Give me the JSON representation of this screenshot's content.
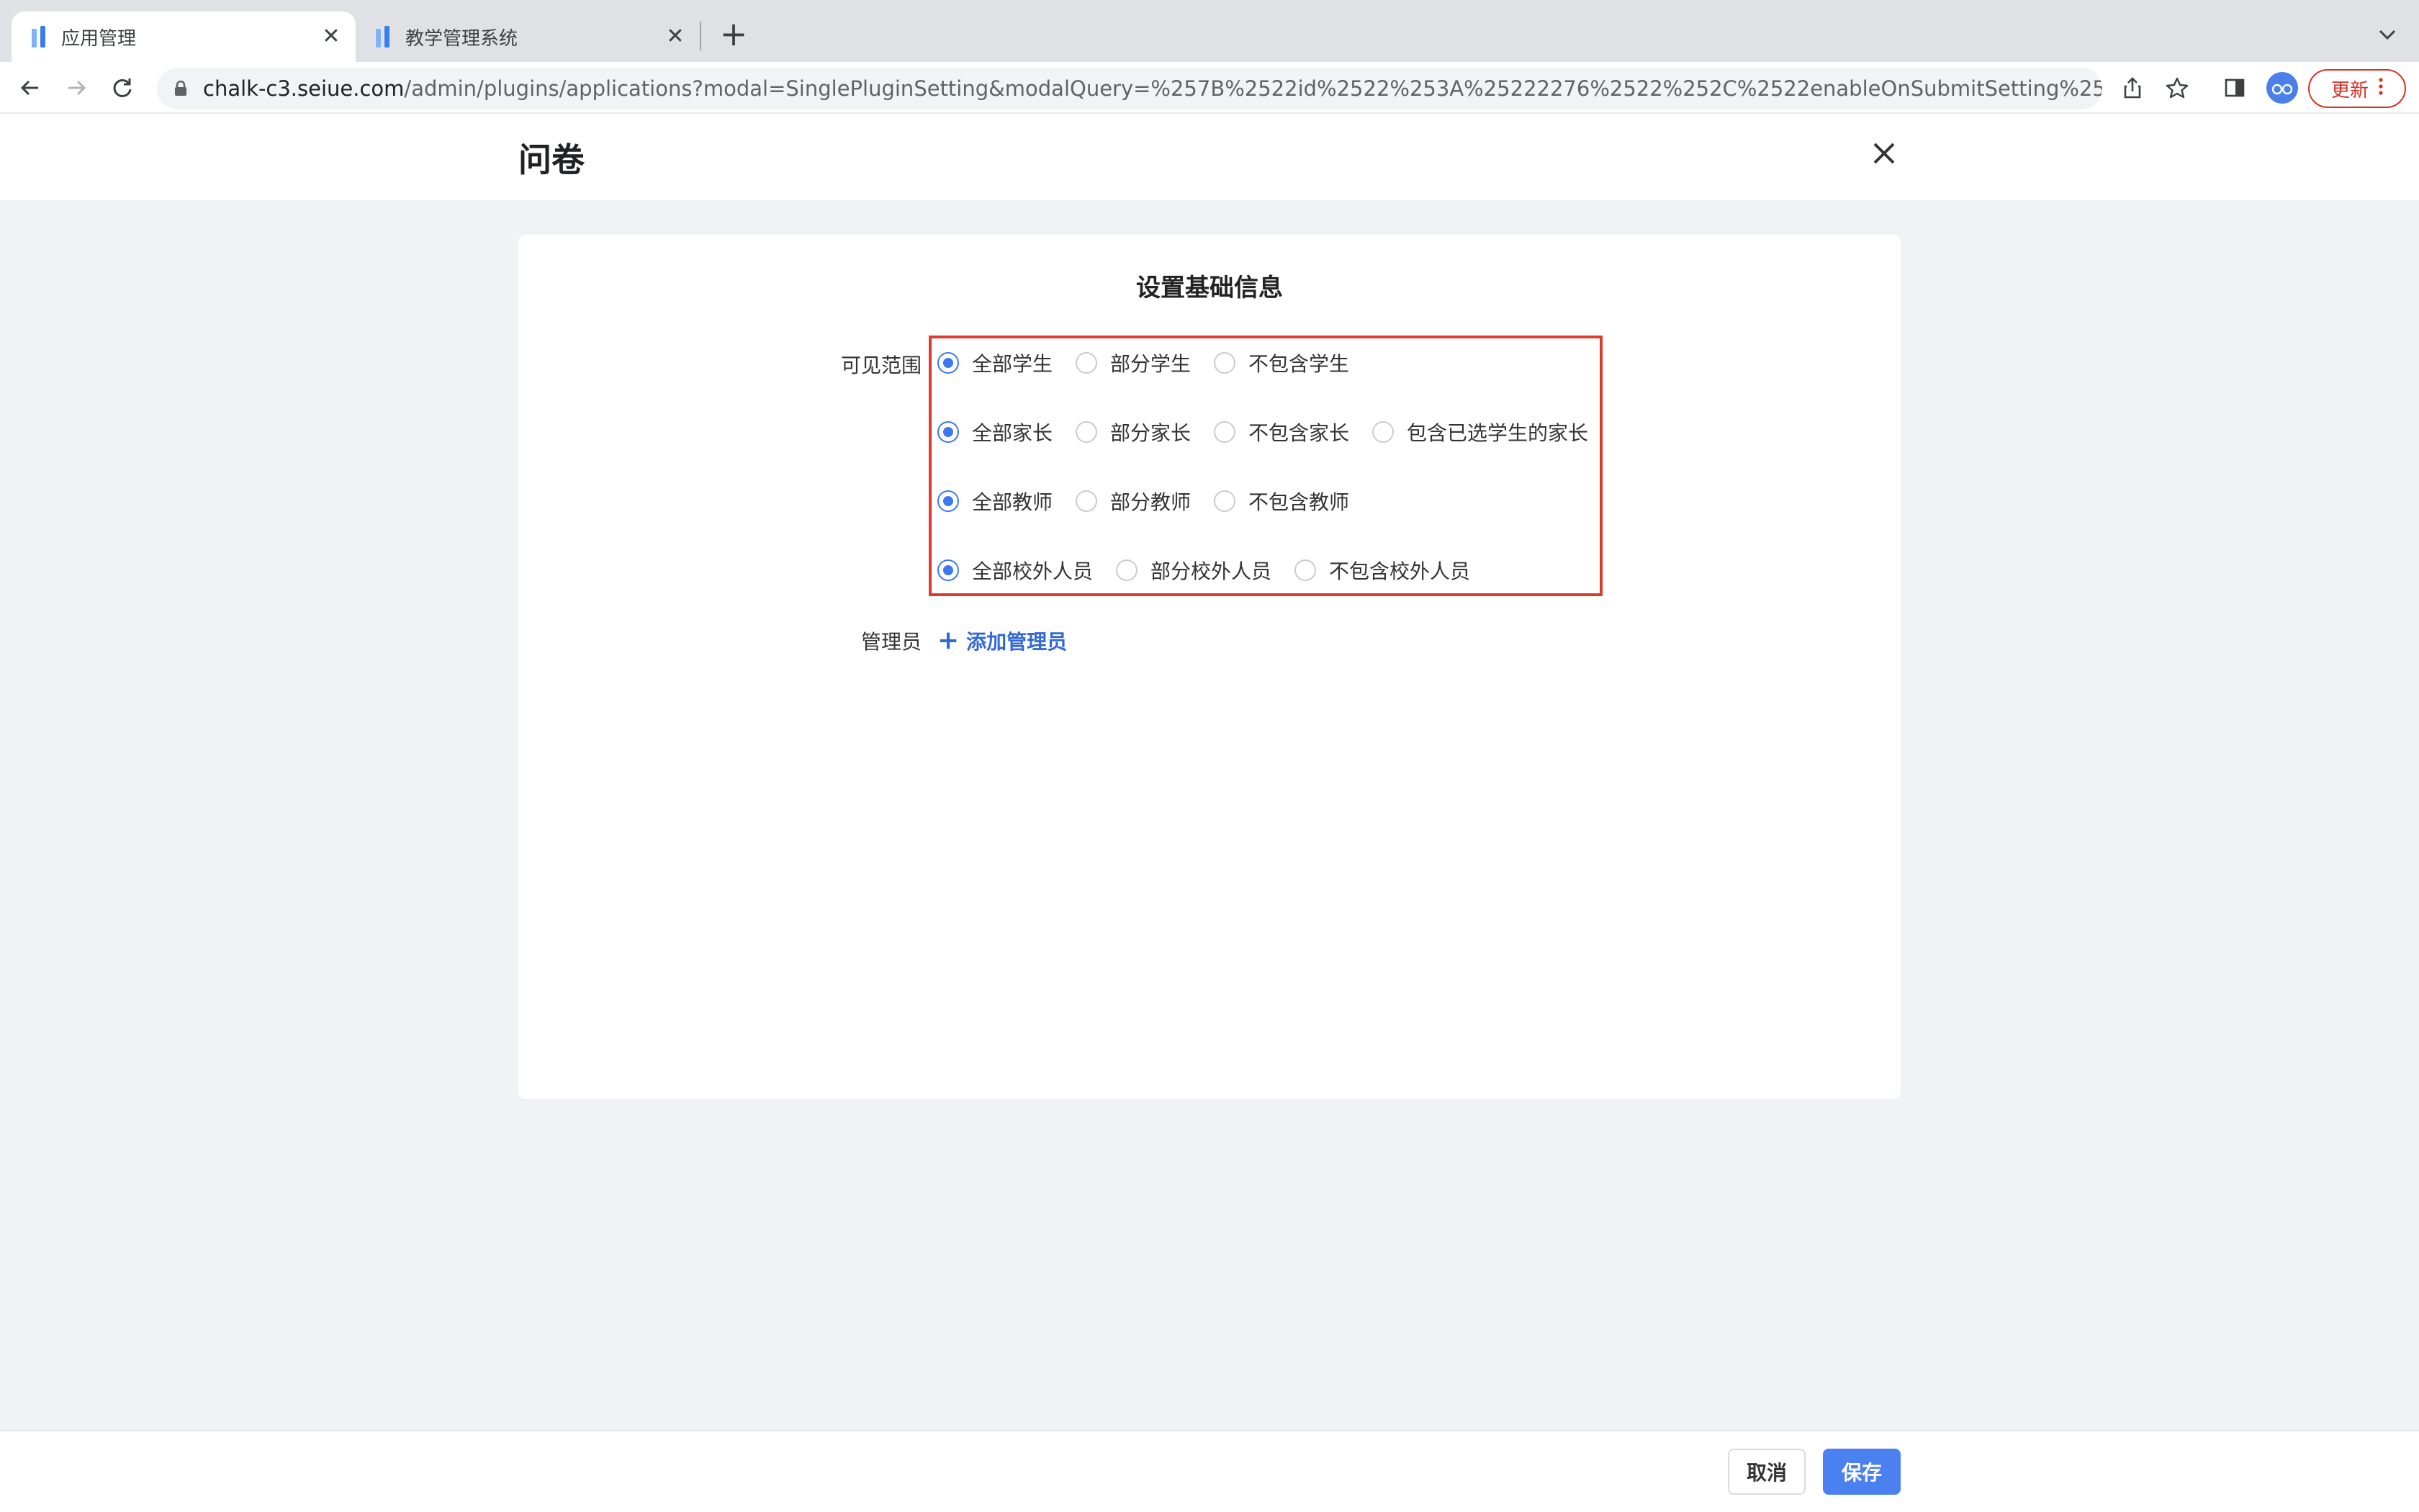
{
  "browser": {
    "tabs": [
      {
        "title": "应用管理",
        "active": true
      },
      {
        "title": "教学管理系统",
        "active": false
      }
    ],
    "url": {
      "host": "chalk-c3.seiue.com",
      "path": "/admin/plugins/applications?modal=SinglePluginSetting&modalQuery=%257B%2522id%2522%253A%25222276%2522%252C%2522enableOnSubmitSetting%2522%253A%25..."
    },
    "update_label": "更新",
    "colors": {
      "update": "#d93025",
      "accent": "#3c78f0"
    }
  },
  "modal": {
    "title": "问卷"
  },
  "form": {
    "section_title": "设置基础信息",
    "visibility_label": "可见范围",
    "visibility_groups": [
      {
        "options": [
          {
            "label": "全部学生",
            "checked": true
          },
          {
            "label": "部分学生",
            "checked": false
          },
          {
            "label": "不包含学生",
            "checked": false
          }
        ]
      },
      {
        "options": [
          {
            "label": "全部家长",
            "checked": true
          },
          {
            "label": "部分家长",
            "checked": false
          },
          {
            "label": "不包含家长",
            "checked": false
          },
          {
            "label": "包含已选学生的家长",
            "checked": false
          }
        ]
      },
      {
        "options": [
          {
            "label": "全部教师",
            "checked": true
          },
          {
            "label": "部分教师",
            "checked": false
          },
          {
            "label": "不包含教师",
            "checked": false
          }
        ]
      },
      {
        "options": [
          {
            "label": "全部校外人员",
            "checked": true
          },
          {
            "label": "部分校外人员",
            "checked": false
          },
          {
            "label": "不包含校外人员",
            "checked": false
          }
        ]
      }
    ],
    "admin_label": "管理员",
    "add_admin_label": "添加管理员"
  },
  "footer": {
    "cancel_label": "取消",
    "save_label": "保存"
  }
}
